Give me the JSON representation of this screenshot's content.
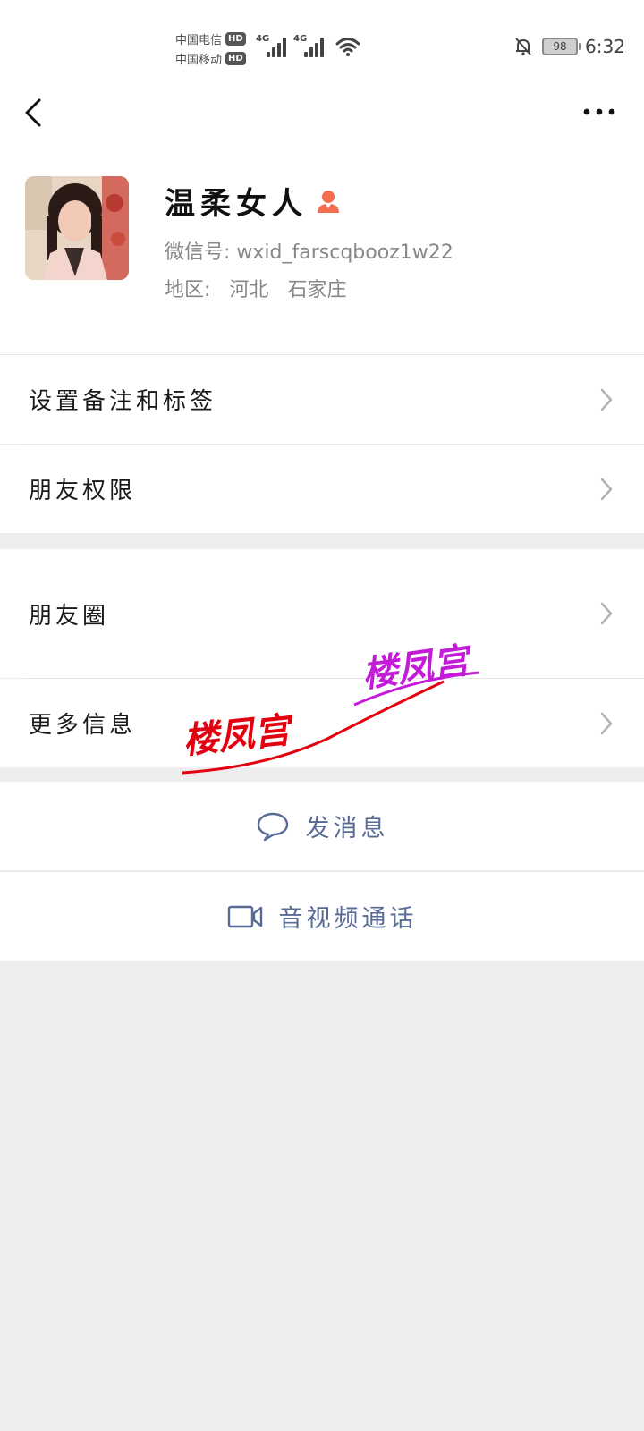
{
  "status_bar": {
    "carriers": [
      {
        "name": "中国电信",
        "badge": "HD"
      },
      {
        "name": "中国移动",
        "badge": "HD"
      }
    ],
    "network": [
      "4G",
      "4G"
    ],
    "battery": "98",
    "time": "6:32",
    "icons": [
      "signal-icon",
      "wifi-icon",
      "mute-bell-icon",
      "battery-icon"
    ]
  },
  "nav": {
    "back_icon": "chevron-left-icon",
    "more_icon": "more-dots-icon"
  },
  "profile": {
    "nickname": "温柔女人",
    "gender_icon": "female-icon",
    "gender_color": "#f26e4f",
    "wxid_label": "微信号:",
    "wxid_value": "wxid_farscqbooz1w22",
    "region_label": "地区:",
    "province": "河北",
    "city": "石家庄"
  },
  "menu": {
    "remark_tags": "设置备注和标签",
    "permissions": "朋友权限",
    "moments": "朋友圈",
    "more_info": "更多信息"
  },
  "actions": {
    "send_message": "发消息",
    "av_call": "音视频通话",
    "link_color": "#576b95"
  },
  "watermark": {
    "text_red": "楼凤宫",
    "text_purple": "楼凤宫",
    "red": "#e3000f",
    "purple": "#c41bd8"
  }
}
